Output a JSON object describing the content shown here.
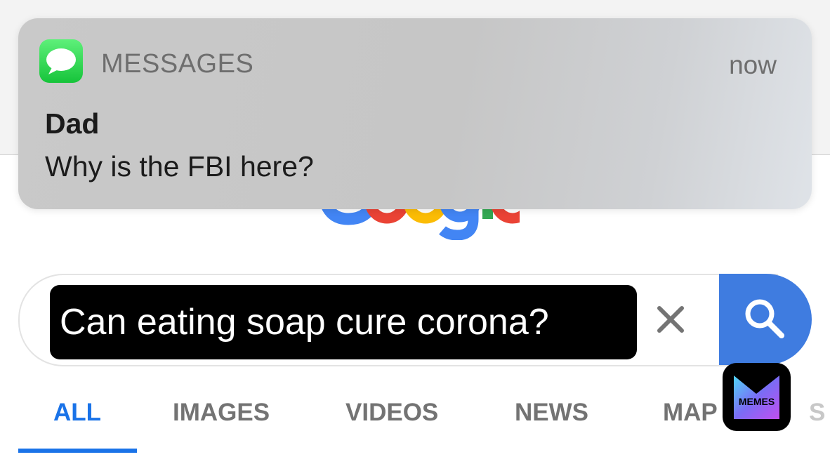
{
  "notification": {
    "app_name": "MESSAGES",
    "time": "now",
    "sender": "Dad",
    "message": "Why is the FBI here?"
  },
  "search": {
    "query": "Can eating soap cure corona?",
    "clear_icon": "close-icon",
    "search_icon": "magnifier-icon"
  },
  "tabs": [
    {
      "label": "ALL",
      "active": true
    },
    {
      "label": "IMAGES",
      "active": false
    },
    {
      "label": "VIDEOS",
      "active": false
    },
    {
      "label": "NEWS",
      "active": false
    },
    {
      "label": "MAP",
      "active": false
    },
    {
      "label": "S",
      "active": false
    }
  ],
  "watermark": {
    "label": "MEMES"
  },
  "colors": {
    "accent_blue": "#1a73e8",
    "search_button": "#3f7ce0",
    "messages_green": "#2fd34b"
  }
}
